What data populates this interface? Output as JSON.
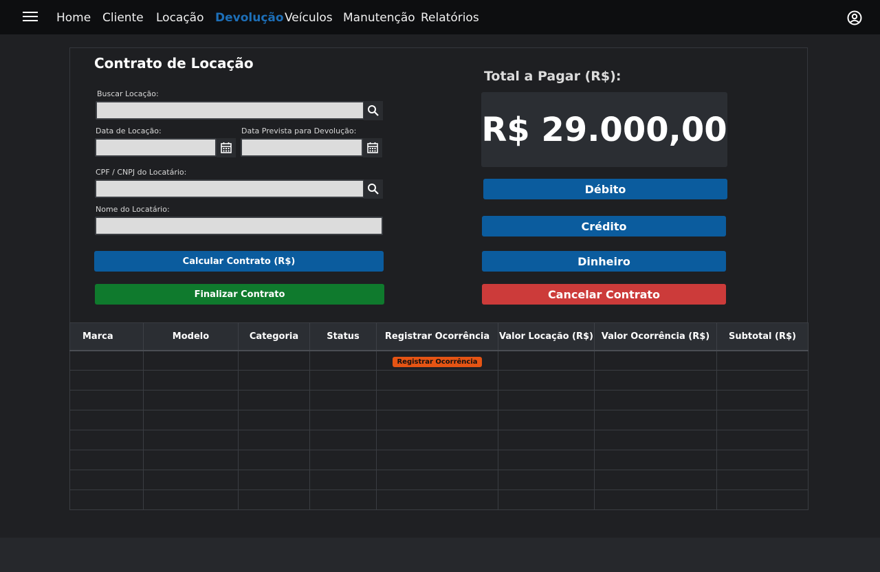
{
  "nav": {
    "items": [
      {
        "label": "Home"
      },
      {
        "label": "Cliente"
      },
      {
        "label": "Locação"
      },
      {
        "label": "Devolução"
      },
      {
        "label": "Veículos"
      },
      {
        "label": "Manutenção"
      },
      {
        "label": "Relatórios"
      }
    ],
    "active": "Devolução"
  },
  "form": {
    "title": "Contrato de Locação",
    "buscar_label": "Buscar Locação:",
    "data_locacao_label": "Data de Locação:",
    "data_prevista_label": "Data Prevista para Devolução:",
    "cpf_label": "CPF / CNPJ do Locatário:",
    "nome_label": "Nome do Locatário:",
    "buscar_value": "",
    "data_locacao_value": "",
    "data_prevista_value": "",
    "cpf_value": "",
    "nome_value": "",
    "calcular_label": "Calcular Contrato (R$)",
    "finalizar_label": "Finalizar Contrato"
  },
  "payment": {
    "total_label": "Total a Pagar (R$):",
    "total_value": "R$ 29.000,00",
    "debito_label": "Débito",
    "credito_label": "Crédito",
    "dinheiro_label": "Dinheiro",
    "cancelar_label": "Cancelar Contrato"
  },
  "table": {
    "headers": [
      "Marca",
      "Modelo",
      "Categoria",
      "Status",
      "Registrar Ocorrência",
      "Valor Locação (R$)",
      "Valor Ocorrência (R$)",
      "Subtotal (R$)"
    ],
    "occurrence_button": "Registrar Ocorrência"
  },
  "colors": {
    "active_nav": "#1d6fb8",
    "primary": "#0b5c9e",
    "success": "#0f7a2d",
    "danger": "#cc3b3a",
    "warning": "#e55414"
  },
  "icons": {
    "menu": "menu-icon",
    "user": "account-circle-icon",
    "search": "search-icon",
    "calendar": "calendar-icon"
  }
}
